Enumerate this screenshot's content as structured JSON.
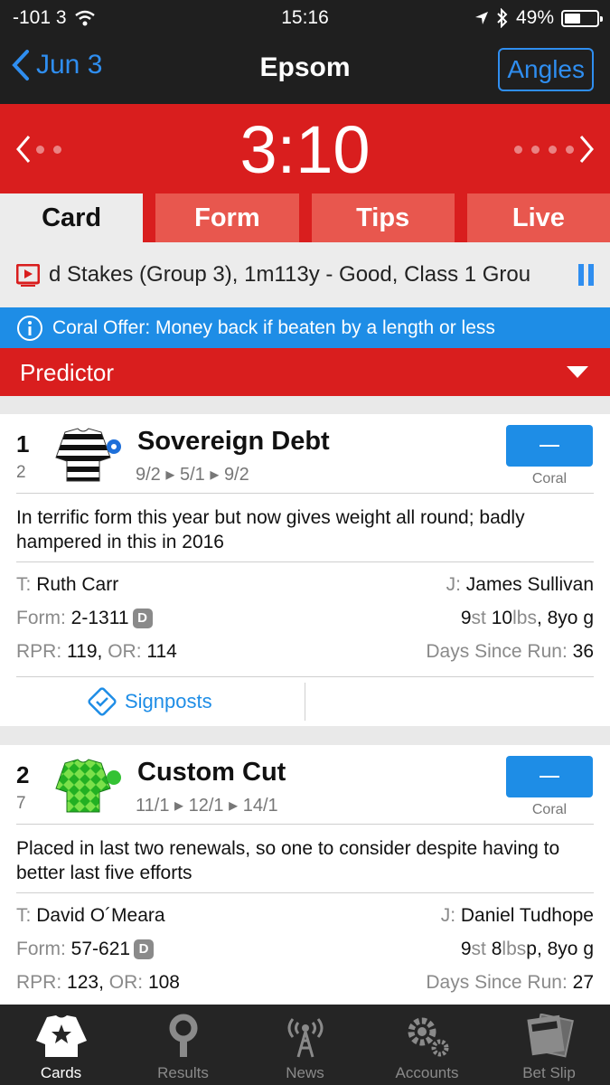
{
  "status_bar": {
    "signal": "-101 3",
    "time": "15:16",
    "battery": "49%",
    "battery_level": 0.49
  },
  "nav": {
    "back_label": "Jun 3",
    "title": "Epsom",
    "angles_label": "Angles"
  },
  "race": {
    "time": "3:10"
  },
  "tabs": [
    {
      "label": "Card",
      "active": true
    },
    {
      "label": "Form",
      "active": false
    },
    {
      "label": "Tips",
      "active": false
    },
    {
      "label": "Live",
      "active": false
    }
  ],
  "race_info": {
    "text": "d Stakes (Group 3), 1m113y - Good, Class 1 Grou"
  },
  "offer": {
    "text": "Coral Offer: Money back if beaten by a length or less"
  },
  "predictor": {
    "label": "Predictor"
  },
  "runners": [
    {
      "number": "1",
      "draw": "2",
      "name": "Sovereign Debt",
      "odds": [
        "9/2",
        "5/1",
        "9/2"
      ],
      "bookmaker": "Coral",
      "comment": "In terrific form this year but now gives weight all round; badly hampered in this in 2016",
      "trainer_label": "T:",
      "trainer": "Ruth Carr",
      "jockey_label": "J:",
      "jockey": "James Sullivan",
      "form_label": "Form:",
      "form": "2-1311",
      "form_badge": "D",
      "weight_st": "9",
      "st_label": "st",
      "weight_lbs": "10",
      "lbs_label": "lbs",
      "age_sex": ", 8yo g",
      "rpr_label": "RPR:",
      "rpr": "119",
      "or_label": "OR:",
      "or": "114",
      "dsr_label": "Days Since Run:",
      "dsr": "36",
      "signposts_label": "Signposts"
    },
    {
      "number": "2",
      "draw": "7",
      "name": "Custom Cut",
      "odds": [
        "11/1",
        "12/1",
        "14/1"
      ],
      "bookmaker": "Coral",
      "comment": "Placed in last two renewals, so one to consider despite having to better last five efforts",
      "trainer_label": "T:",
      "trainer": "David O´Meara",
      "jockey_label": "J:",
      "jockey": "Daniel Tudhope",
      "form_label": "Form:",
      "form": "57-621",
      "form_badge": "D",
      "weight_st": "9",
      "st_label": "st",
      "weight_lbs": "8",
      "lbs_label": "lbs",
      "headgear": " p",
      "age_sex": ", 8yo g",
      "rpr_label": "RPR:",
      "rpr": "123",
      "or_label": "OR:",
      "or": "108",
      "dsr_label": "Days Since Run:",
      "dsr": "27"
    }
  ],
  "tab_bar": [
    {
      "label": "Cards",
      "icon": "jacket-star-icon",
      "active": true
    },
    {
      "label": "Results",
      "icon": "magnifier-icon",
      "active": false
    },
    {
      "label": "News",
      "icon": "broadcast-tower-icon",
      "active": false
    },
    {
      "label": "Accounts",
      "icon": "gears-icon",
      "active": false
    },
    {
      "label": "Bet Slip",
      "icon": "slips-icon",
      "active": false
    }
  ],
  "colors": {
    "red": "#d91e1e",
    "blue": "#1e8de6",
    "dark": "#1f1f1f",
    "tab_inactive": "#e8574e"
  }
}
